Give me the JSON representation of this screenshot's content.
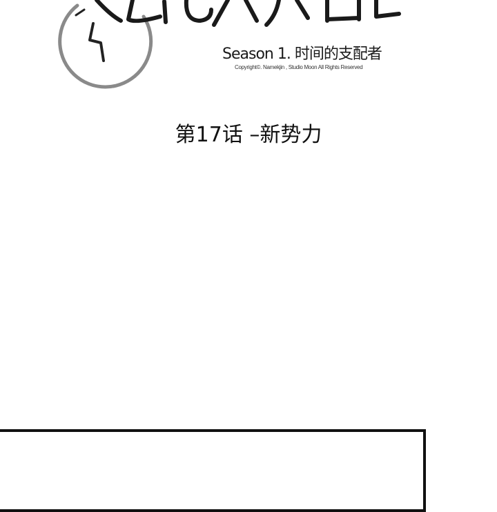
{
  "logo": {
    "icon": "clock-icon",
    "title_art": "title-calligraphy-logo"
  },
  "header": {
    "season": "Season 1. 时间的支配者",
    "copyright": "Copyright©. Namekjin , Studio Moon All Rights Reserved"
  },
  "chapter": {
    "title": "第17话 –新势力"
  },
  "colors": {
    "background": "#ffffff",
    "ink": "#111111",
    "clock_gray": "#8a8a8a"
  }
}
